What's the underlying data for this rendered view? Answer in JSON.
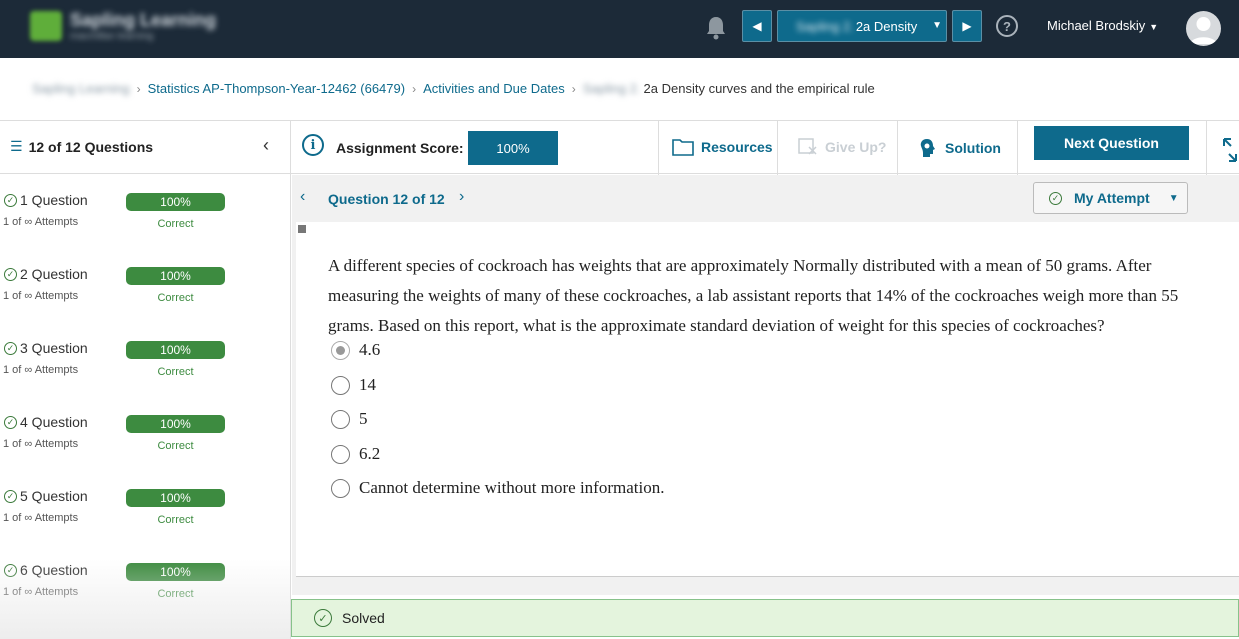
{
  "topbar": {
    "logo_line1": "Sapling Learning",
    "logo_line2": "macmillan learning",
    "assignment_select_blurred": "Sapling 2.",
    "assignment_select_visible": "2a Density",
    "user_name": "Michael Brodskiy",
    "help_glyph": "?"
  },
  "breadcrumb": {
    "root": "Sapling Learning",
    "course": "Statistics AP-Thompson-Year-12462 (66479)",
    "activities": "Activities and Due Dates",
    "current_blurred": "Sapling 2.",
    "current": "2a Density curves and the empirical rule"
  },
  "toolbar": {
    "question_count": "12 of 12 Questions",
    "score_label": "Assignment Score:",
    "score_value": "100%",
    "resources": "Resources",
    "give_up": "Give Up?",
    "solution": "Solution",
    "next_question": "Next Question"
  },
  "questions": [
    {
      "title": "1 Question",
      "attempts": "1 of ∞ Attempts",
      "score": "100%",
      "status": "Correct"
    },
    {
      "title": "2 Question",
      "attempts": "1 of ∞ Attempts",
      "score": "100%",
      "status": "Correct"
    },
    {
      "title": "3 Question",
      "attempts": "1 of ∞ Attempts",
      "score": "100%",
      "status": "Correct"
    },
    {
      "title": "4 Question",
      "attempts": "1 of ∞ Attempts",
      "score": "100%",
      "status": "Correct"
    },
    {
      "title": "5 Question",
      "attempts": "1 of ∞ Attempts",
      "score": "100%",
      "status": "Correct"
    },
    {
      "title": "6 Question",
      "attempts": "1 of ∞ Attempts",
      "score": "100%",
      "status": "Correct"
    }
  ],
  "main": {
    "question_label": "Question 12 of 12",
    "my_attempt": "My Attempt",
    "question_text": "A different species of cockroach has weights that are approximately Normally distributed with a mean of 50 grams. After measuring the weights of many of these cockroaches, a lab assistant reports that 14% of the cockroaches weigh more than 55 grams. Based on this report, what is the approximate standard deviation of weight for this species of cockroaches?",
    "choices": [
      "4.6",
      "14",
      "5",
      "6.2",
      "Cannot determine without more information."
    ],
    "selected_choice": "4.6"
  },
  "status": {
    "solved": "Solved"
  },
  "colors": {
    "topbar": "#1c2a38",
    "accent": "#0e6a8c",
    "correct_green": "#3d8b40",
    "solved_bg": "#e4f4dd"
  }
}
